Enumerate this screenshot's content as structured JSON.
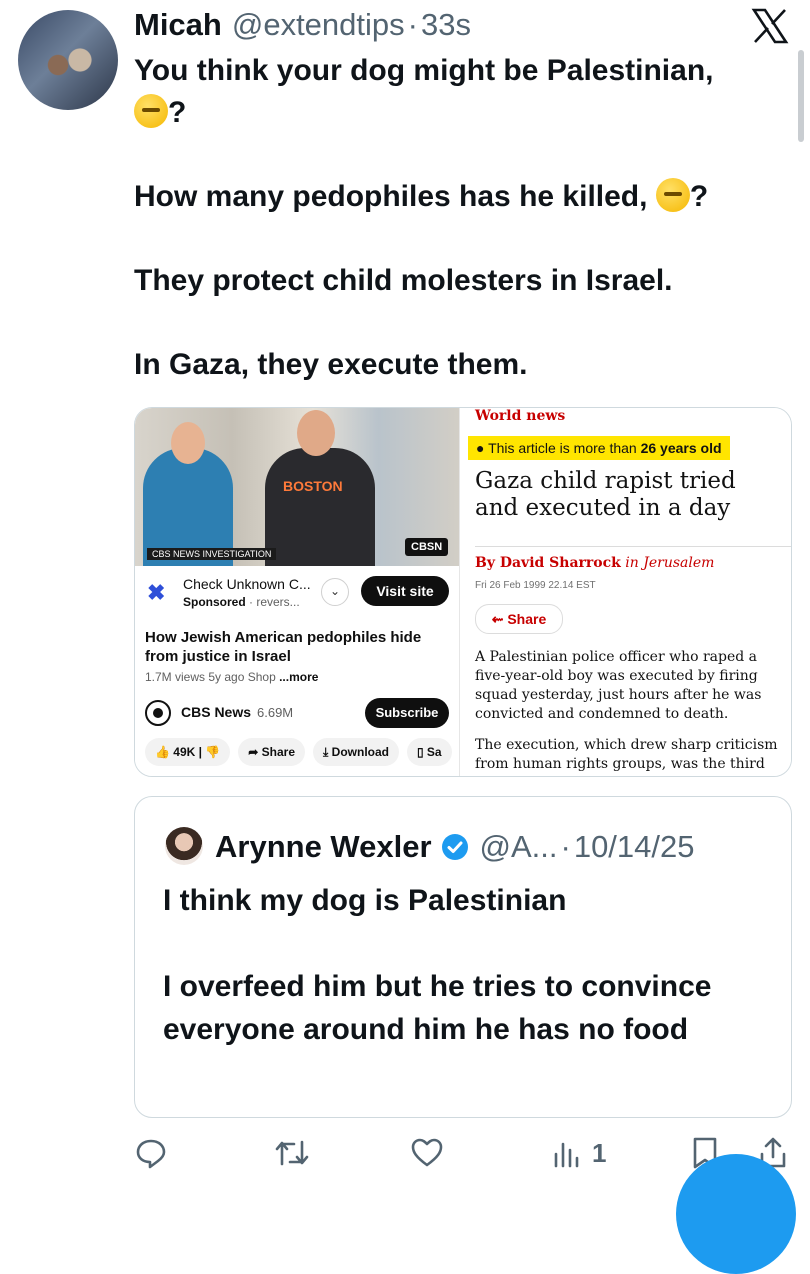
{
  "author": {
    "name": "Micah",
    "handle": "@extendtips",
    "separator": "·",
    "time": "33s"
  },
  "tweet_lines": [
    "You think your dog might be Palestinian,",
    "?",
    "How many pedophiles has he killed,",
    "?",
    "They protect child molesters in Israel.",
    "In Gaza, they execute them."
  ],
  "video": {
    "badge": "CBS NEWS INVESTIGATION",
    "network_logo": "CBSN",
    "shirt_text": "BOSTON",
    "ad_title": "Check Unknown C...",
    "ad_sponsored": "Sponsored",
    "ad_sub": " · revers...",
    "visit_label": "Visit site",
    "title": "How Jewish American pedophiles hide from justice in Israel",
    "meta": "1.7M views  5y ago  Shop",
    "more": "...more",
    "channel": "CBS News",
    "subscribers": "6.69M",
    "subscribe_label": "Subscribe",
    "likes": "49K",
    "share_label": "Share",
    "download_label": "Download",
    "save_label": "Sa"
  },
  "article": {
    "section": "World news",
    "notice_prefix": "This article is more than ",
    "notice_age": "26 years old",
    "headline": "Gaza child rapist tried and executed in a day",
    "byline_prefix": "By ",
    "byline_author": "David Sharrock",
    "byline_suffix": " in Jerusalem",
    "dateline": "Fri 26 Feb 1999 22.14 EST",
    "share_label": "Share",
    "paragraph1": "A Palestinian police officer who raped a five-year-old boy was executed by firing squad yesterday, just hours after he was convicted and condemned to death.",
    "paragraph2": "The execution, which drew sharp criticism from human rights groups, was the third"
  },
  "quoted": {
    "name": "Arynne Wexler",
    "handle": "@A...",
    "separator": "·",
    "date": "10/14/25",
    "lines": [
      "I think my dog is Palestinian",
      "I overfeed him but he tries to convince everyone around him he has no food"
    ]
  },
  "actions": {
    "views": "1"
  },
  "colors": {
    "accent": "#1d9bf0",
    "secondary_text": "#536471",
    "guardian_red": "#c70000",
    "notice_yellow": "#ffe500"
  },
  "icons": [
    "x-logo-icon",
    "raised-eyebrow-emoji",
    "thinking-face-emoji",
    "verified-badge-icon",
    "reply-icon",
    "retweet-icon",
    "like-icon",
    "views-icon",
    "bookmark-icon",
    "share-icon"
  ]
}
